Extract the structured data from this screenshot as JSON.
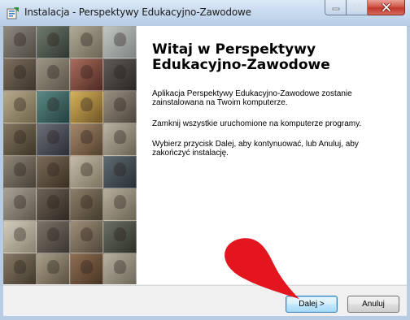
{
  "window": {
    "title": "Instalacja - Perspektywy Edukacyjno-Zawodowe"
  },
  "welcome": {
    "title": "Witaj w Perspektywy Edukacyjno-Zawodowe",
    "paragraph1": "Aplikacja Perspektywy Edukacyjno-Zawodowe zostanie zainstalowana na Twoim komputerze.",
    "paragraph2": "Zamknij wszystkie uruchomione na komputerze programy.",
    "paragraph3": "Wybierz przycisk Dalej, aby kontynuować, lub Anuluj, aby zakończyć instalację."
  },
  "buttons": {
    "next": "Dalej >",
    "cancel": "Anuluj"
  },
  "icons": {
    "app": "installer-icon",
    "minimize": "minimize-icon",
    "maximize": "maximize-icon",
    "close": "close-icon",
    "marker": "red-pointer-marker"
  },
  "colors": {
    "marker": "#e3151f",
    "close_button": "#c1392b",
    "default_button_border": "#3c7fb1"
  }
}
